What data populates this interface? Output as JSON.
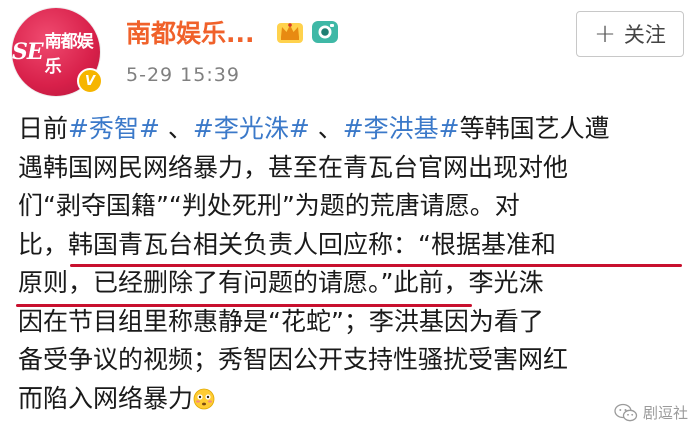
{
  "account": {
    "name": "南都娱乐...",
    "avatar_text": "南都娱乐",
    "avatar_mark": "SE",
    "verified_mark": "V",
    "timestamp": "5-29 15:39"
  },
  "follow_button": {
    "icon": "+",
    "label": "关注"
  },
  "icons": {
    "crown": "crown-icon",
    "camera": "camera-icon",
    "emoji": "flushed-face-icon"
  },
  "post": {
    "l1_a": "日前",
    "tag1": "#秀智#",
    "l1_b": " 、",
    "tag2": "#李光洙#",
    "l1_c": " 、",
    "tag3": "#李洪基#",
    "l1_d": "等韩国艺人遭",
    "line2": "遇韩国网民网络暴力，甚至在青瓦台官网出现对他",
    "line3": "们“剥夺国籍”“判处死刑”为题的荒唐请愿。对",
    "line4": "比，韩国青瓦台相关负责人回应称：“根据基准和",
    "line5": "原则，已经删除了有问题的请愿。”此前，李光洙",
    "line6": "因在节目组里称惠静是“花蛇”；李洪基因为看了",
    "line7": "备受争议的视频；秀智因公开支持性骚扰受害网红",
    "line8": "而陷入网络暴力"
  },
  "watermark": {
    "text": "剧逗社"
  },
  "colors": {
    "name": "#f0612a",
    "hashtag": "#3b79c9",
    "underline": "#c8102e",
    "avatar": "#d8204a"
  }
}
